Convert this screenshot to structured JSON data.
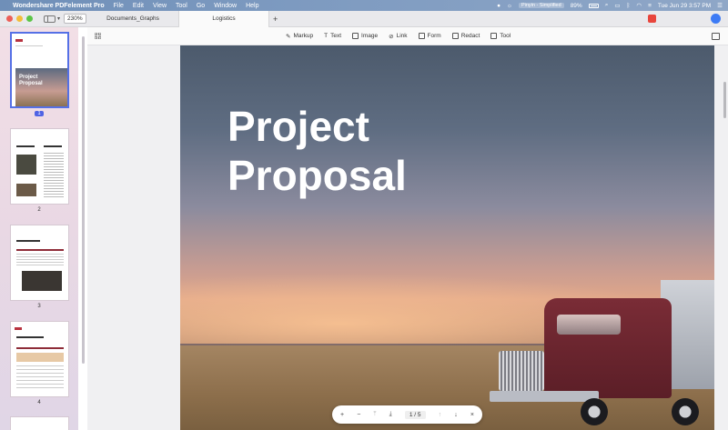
{
  "menubar": {
    "app_name": "Wondershare PDFelement Pro",
    "menus": [
      "File",
      "Edit",
      "View",
      "Tool",
      "Go",
      "Window",
      "Help"
    ],
    "input_source": "Pinyin - Simplified",
    "battery": "89%",
    "datetime": "Tue Jun 29  3:57 PM"
  },
  "tabbar": {
    "zoom": "230%",
    "tabs": [
      {
        "label": "Documents_Graphs"
      },
      {
        "label": "Logistics"
      }
    ],
    "add_tab": "+"
  },
  "toolbar": {
    "tools": [
      {
        "label": "Markup",
        "icon": "pen-icon"
      },
      {
        "label": "Text",
        "icon": "text-icon"
      },
      {
        "label": "Image",
        "icon": "image-icon"
      },
      {
        "label": "Link",
        "icon": "link-icon"
      },
      {
        "label": "Form",
        "icon": "form-icon"
      },
      {
        "label": "Redact",
        "icon": "redact-icon"
      },
      {
        "label": "Tool",
        "icon": "toolbox-icon"
      }
    ]
  },
  "sidebar": {
    "thumbnails": [
      {
        "page": "1",
        "selected": true
      },
      {
        "page": "2",
        "selected": false
      },
      {
        "page": "3",
        "selected": false
      },
      {
        "page": "4",
        "selected": false
      }
    ]
  },
  "document": {
    "title_line1": "Project",
    "title_line2": "Proposal"
  },
  "pager": {
    "zoom_in": "+",
    "zoom_out": "−",
    "current_page": "1",
    "separator": "/",
    "total_pages": "5",
    "close": "×"
  },
  "colors": {
    "accent": "#4f63e4",
    "truck_red": "#7a2c36",
    "sidebar_bg": "#ecdbe5"
  }
}
